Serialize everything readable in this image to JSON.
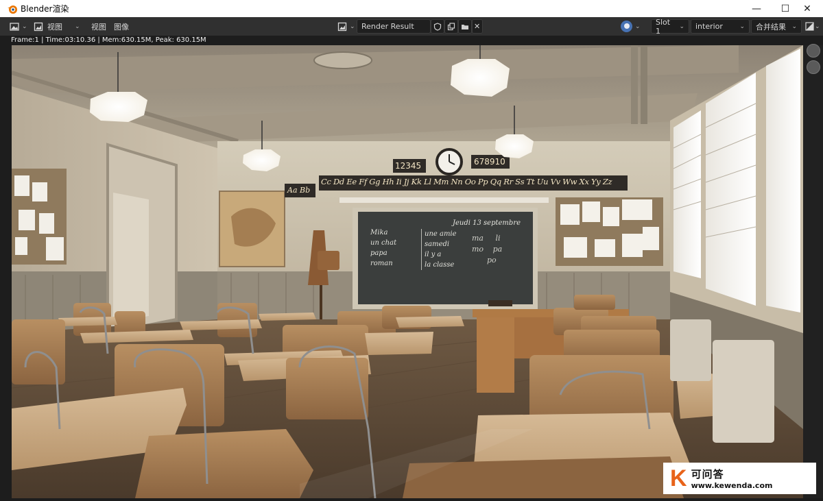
{
  "window": {
    "title": "Blender渲染",
    "controls": {
      "minimize": "—",
      "maximize": "☐",
      "close": "✕"
    }
  },
  "header": {
    "editor_type_icon": "image-editor-icon",
    "view_toggle_icon": "image-view-icon",
    "view_dropdown_label": "视图",
    "menu": {
      "view": "视图",
      "image": "图像"
    },
    "image_name": "Render Result",
    "slot": "Slot 1",
    "view_layer": "interior",
    "pass": "合并结果",
    "colors": {
      "bar": "#303030",
      "field": "#1f1f1f",
      "accent": "#4772b3"
    }
  },
  "info": {
    "text": "Frame:1 | Time:03:10.36 | Mem:630.15M, Peak: 630.15M"
  },
  "render": {
    "numbers_left": "12345",
    "numbers_right": "678910",
    "alphabet_left": "Aa Bb",
    "alphabet_right": "Cc Dd Ee Ff Gg Hh Ii Jj Kk Ll Mm Nn Oo Pp Qq Rr Ss Tt Uu Vv Ww Xx Yy Zz",
    "board_date": "Jeudi 13 septembre",
    "board_col1": [
      "Mika",
      "un chat",
      "papa",
      "roman"
    ],
    "board_col2": [
      "une amie",
      "samedi",
      "il y a",
      "la classe"
    ],
    "board_col3": [
      "ma",
      "li",
      "mo",
      "pa",
      "po"
    ]
  },
  "watermark": {
    "logo_letter": "K",
    "name": "可问答",
    "url": "www.kewenda.com",
    "color": "#e8631a"
  }
}
